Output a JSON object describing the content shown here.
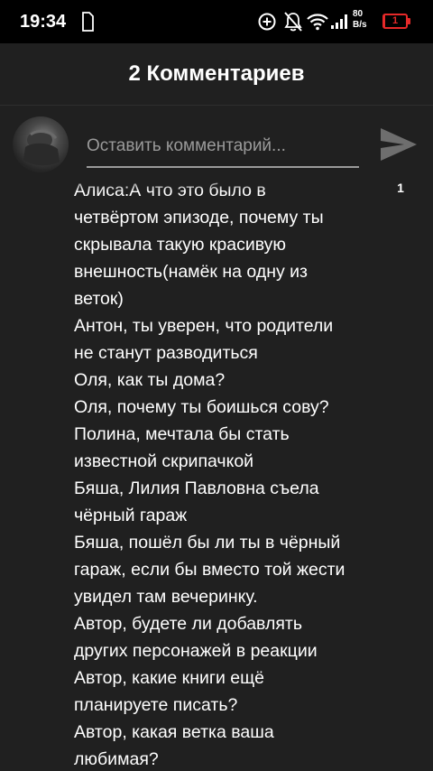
{
  "status_bar": {
    "time": "19:34",
    "net_speed_value": "80",
    "net_speed_unit": "B/s",
    "battery_level": "1",
    "battery_color": "#e52929",
    "icons": [
      "sim-card-icon",
      "data-saver-icon",
      "notifications-off-icon",
      "wifi-icon",
      "signal-icon",
      "battery-icon"
    ]
  },
  "header": {
    "title": "2 Комментариев"
  },
  "comment_input": {
    "placeholder": "Оставить комментарий...",
    "value": ""
  },
  "send_icon": "send-icon",
  "comment": {
    "lines": [
      "Алиса:А что это было в",
      "четвёртом эпизоде, почему ты",
      "скрывала такую красивую",
      "внешность(намёк на одну из",
      "веток)",
      "Антон, ты уверен, что родители",
      "не станут разводиться",
      "Оля, как ты дома?",
      "Оля, почему ты боишься сову?",
      "Полина, мечтала бы стать",
      "известной скрипачкой",
      "Бяша, Лилия Павловна съела",
      "чёрный гараж",
      "Бяша, пошёл бы ли ты в чёрный",
      "гараж, если бы вместо той жести",
      "увидел там вечеринку.",
      "Автор, будете ли добавлять",
      "других персонажей в реакции",
      "Автор, какие книги ещё",
      "планируете писать?",
      "Автор, какая ветка ваша",
      "любимая?"
    ],
    "like_count": "1"
  }
}
